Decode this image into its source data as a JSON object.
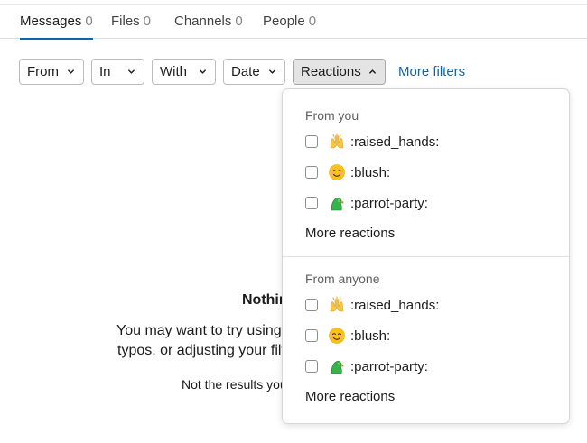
{
  "tabs": [
    {
      "label": "Messages",
      "count": "0"
    },
    {
      "label": "Files",
      "count": "0"
    },
    {
      "label": "Channels",
      "count": "0"
    },
    {
      "label": "People",
      "count": "0"
    }
  ],
  "filters": {
    "from": "From",
    "in": "In",
    "with": "With",
    "date": "Date",
    "reactions": "Reactions",
    "more": "More filters"
  },
  "dropdown": {
    "from_you": {
      "label": "From you",
      "options": [
        ":raised_hands:",
        ":blush:",
        ":parrot-party:"
      ],
      "more": "More reactions"
    },
    "from_anyone": {
      "label": "From anyone",
      "options": [
        ":raised_hands:",
        ":blush:",
        ":parrot-party:"
      ],
      "more": "More reactions"
    }
  },
  "empty": {
    "title": "Nothin",
    "line1": "You may want to try using",
    "line2": "typos, or adjusting your filt",
    "hint": "Not the results you"
  },
  "icons": {
    "chevron": "chevron-down-icon",
    "chevron_open": "chevron-up-icon",
    "emoji": [
      "raised-hands-icon",
      "blush-icon",
      "parrot-party-icon"
    ]
  },
  "colors": {
    "accent": "#1264a3",
    "text": "#1d1c1d",
    "muted": "#616061"
  }
}
